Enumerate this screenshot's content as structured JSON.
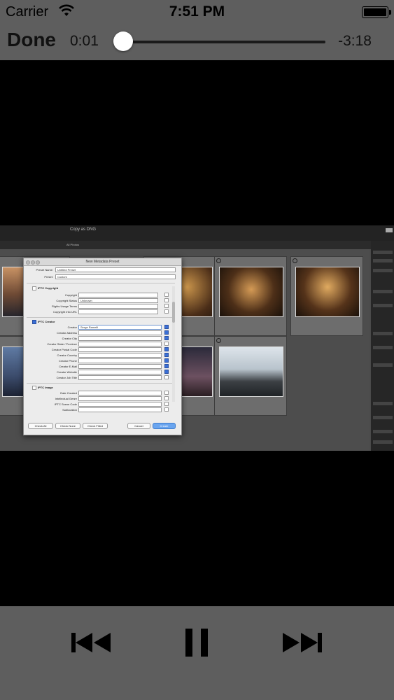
{
  "status_bar": {
    "carrier": "Carrier",
    "time": "7:51 PM"
  },
  "player": {
    "done_label": "Done",
    "elapsed": "0:01",
    "remaining": "-3:18",
    "progress": 0.005
  },
  "lightroom": {
    "top_label": "Copy as DNG",
    "filter_label": "All Photos"
  },
  "dialog": {
    "title": "New Metadata Preset",
    "preset_name_label": "Preset Name:",
    "preset_name_value": "Untitled Preset",
    "preset_label": "Preset:",
    "preset_value": "Custom",
    "section_copyright": "IPTC Copyright",
    "copyright_label": "Copyright",
    "copyright_status_label": "Copyright Status",
    "copyright_status_value": "Unknown",
    "rights_usage_label": "Rights Usage Terms",
    "copyright_url_label": "Copyright Info URL",
    "section_creator": "IPTC Creator",
    "creator_label": "Creator",
    "creator_value": "Serge Ramelli",
    "creator_address_label": "Creator Address",
    "creator_city_label": "Creator City",
    "creator_state_label": "Creator State / Province",
    "creator_postal_label": "Creator Postal Code",
    "creator_country_label": "Creator Country",
    "creator_phone_label": "Creator Phone",
    "creator_email_label": "Creator E-Mail",
    "creator_website_label": "Creator Website",
    "creator_jobtitle_label": "Creator Job Title",
    "section_image": "IPTC Image",
    "date_created_label": "Date Created",
    "intellectual_genre_label": "Intellectual Genre",
    "iptc_scene_label": "IPTC Scene Code",
    "sublocation_label": "Sublocation",
    "btn_check_all": "Check All",
    "btn_check_none": "Check None",
    "btn_check_filled": "Check Filled",
    "btn_cancel": "Cancel",
    "btn_create": "Create"
  }
}
